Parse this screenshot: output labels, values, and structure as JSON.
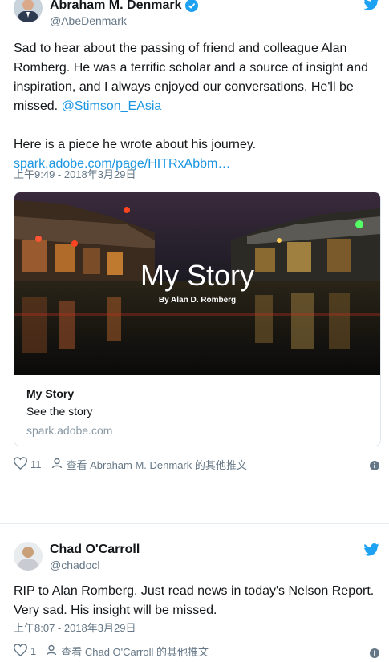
{
  "colors": {
    "link": "#1b95e0",
    "muted": "#657786",
    "verified": "#1da1f2",
    "bird": "#1da1f2"
  },
  "tweets": [
    {
      "name": "Abraham M. Denmark",
      "handle": "@AbeDenmark",
      "text1": "Sad to hear about the passing of friend and colleague Alan Romberg. He was a terrific scholar and a source of insight and inspiration, and I always enjoyed our conversations. He'll be missed.",
      "mention": "@Stimson_EAsia",
      "text2": "Here is a piece he wrote about his journey.",
      "url": "spark.adobe.com/page/HITRxAbbm…",
      "time": "上午9:49 - 2018年3月29日",
      "card": {
        "image_title": "My Story",
        "image_subtitle": "By Alan D. Romberg",
        "title": "My Story",
        "description": "See the story",
        "domain": "spark.adobe.com"
      },
      "likes": "11",
      "view_profile": "查看 Abraham M. Denmark 的其他推文"
    },
    {
      "name": "Chad O'Carroll",
      "handle": "@chadocl",
      "text": "RIP to Alan Romberg. Just read news in today's Nelson Report. Very sad. His insight will be missed.",
      "time": "上午8:07 - 2018年3月29日",
      "likes": "1",
      "view_profile": "查看 Chad O'Carroll 的其他推文"
    }
  ]
}
